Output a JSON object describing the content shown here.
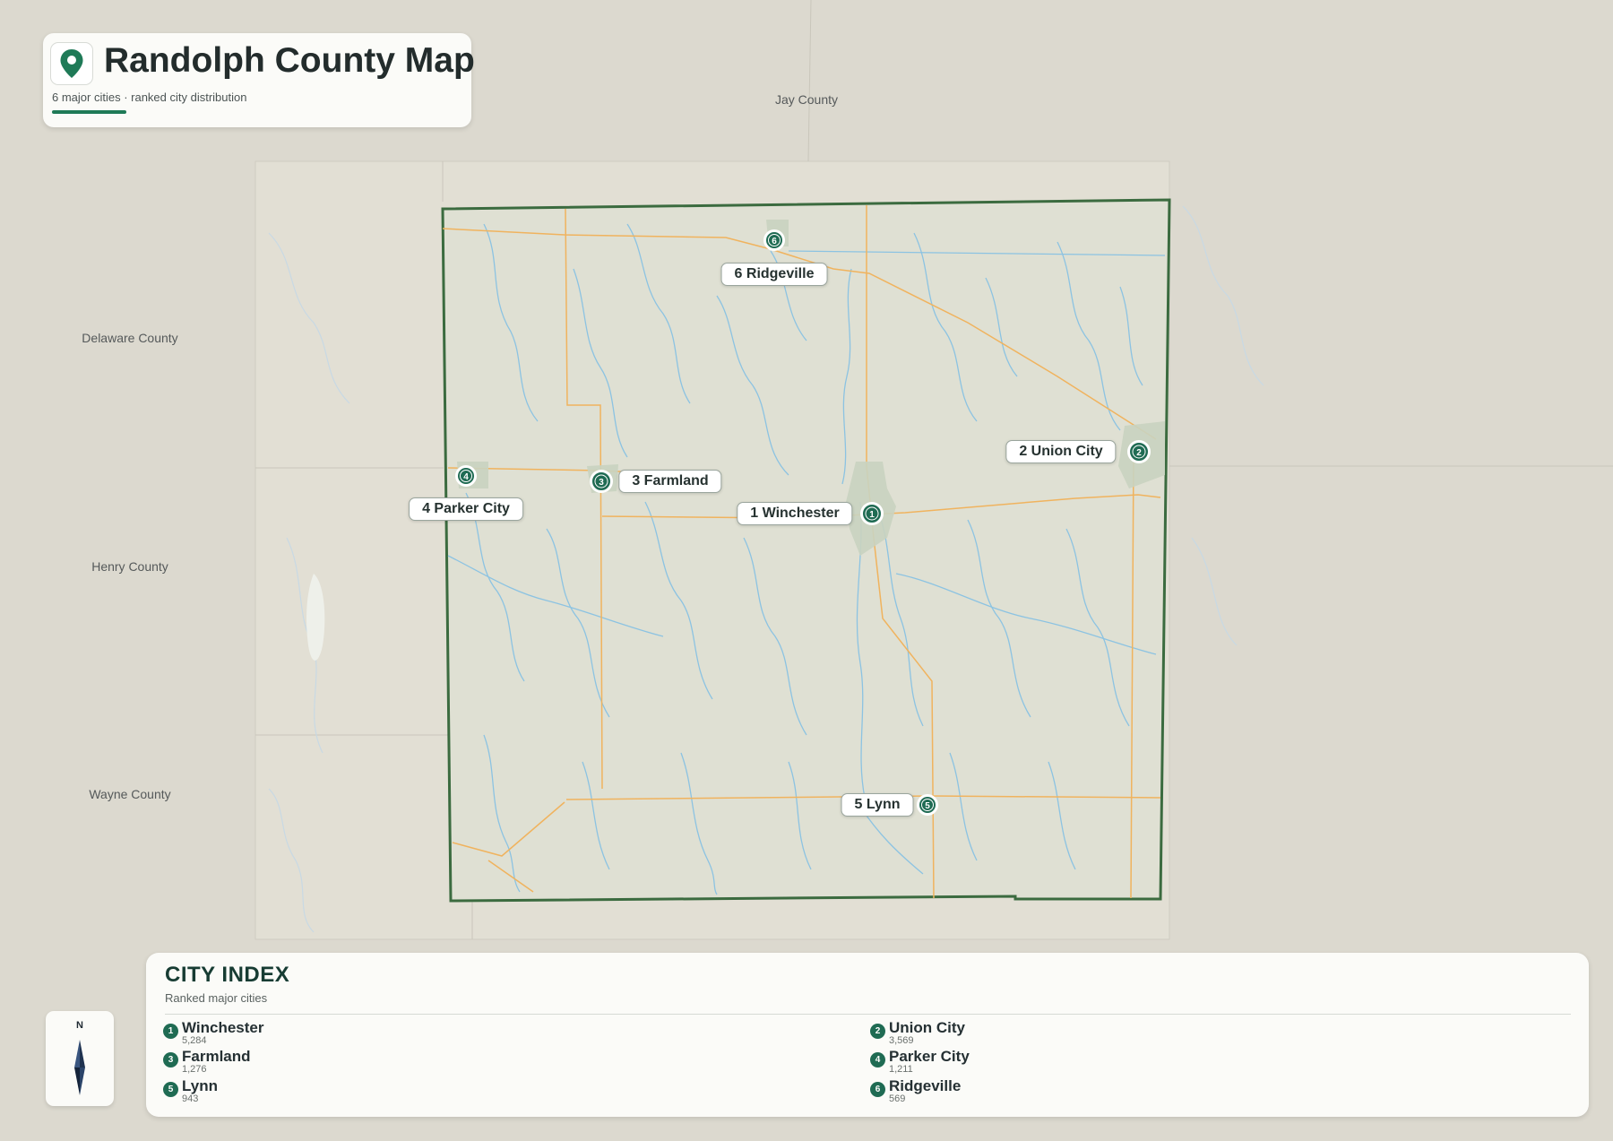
{
  "header": {
    "title": "Randolph County Map",
    "subtitle": "6 major cities · ranked city distribution"
  },
  "surrounding_counties": [
    {
      "name": "Jay County"
    },
    {
      "name": "Delaware County"
    },
    {
      "name": "Henry County"
    },
    {
      "name": "Wayne County"
    }
  ],
  "cities": [
    {
      "rank": 1,
      "name": "Winchester",
      "label": "1 Winchester",
      "population": "5,284"
    },
    {
      "rank": 2,
      "name": "Union City",
      "label": "2 Union City",
      "population": "3,569"
    },
    {
      "rank": 3,
      "name": "Farmland",
      "label": "3 Farmland",
      "population": "1,276"
    },
    {
      "rank": 4,
      "name": "Parker City",
      "label": "4 Parker City",
      "population": "1,211"
    },
    {
      "rank": 5,
      "name": "Lynn",
      "label": "5 Lynn",
      "population": "943"
    },
    {
      "rank": 6,
      "name": "Ridgeville",
      "label": "6 Ridgeville",
      "population": "569"
    }
  ],
  "compass": {
    "north_label": "N"
  },
  "city_index": {
    "title": "CITY INDEX",
    "subtitle": "Ranked major cities"
  },
  "colors": {
    "county_border": "#3b6b3f",
    "county_fill": "#dfe0d3",
    "marker": "#1f6b53",
    "roads": "#f0b35e",
    "rivers": "#8cc3e2",
    "accent": "#1f7a57"
  },
  "icons": {
    "title": "map-pin-icon",
    "compass": "compass-needle-icon"
  }
}
